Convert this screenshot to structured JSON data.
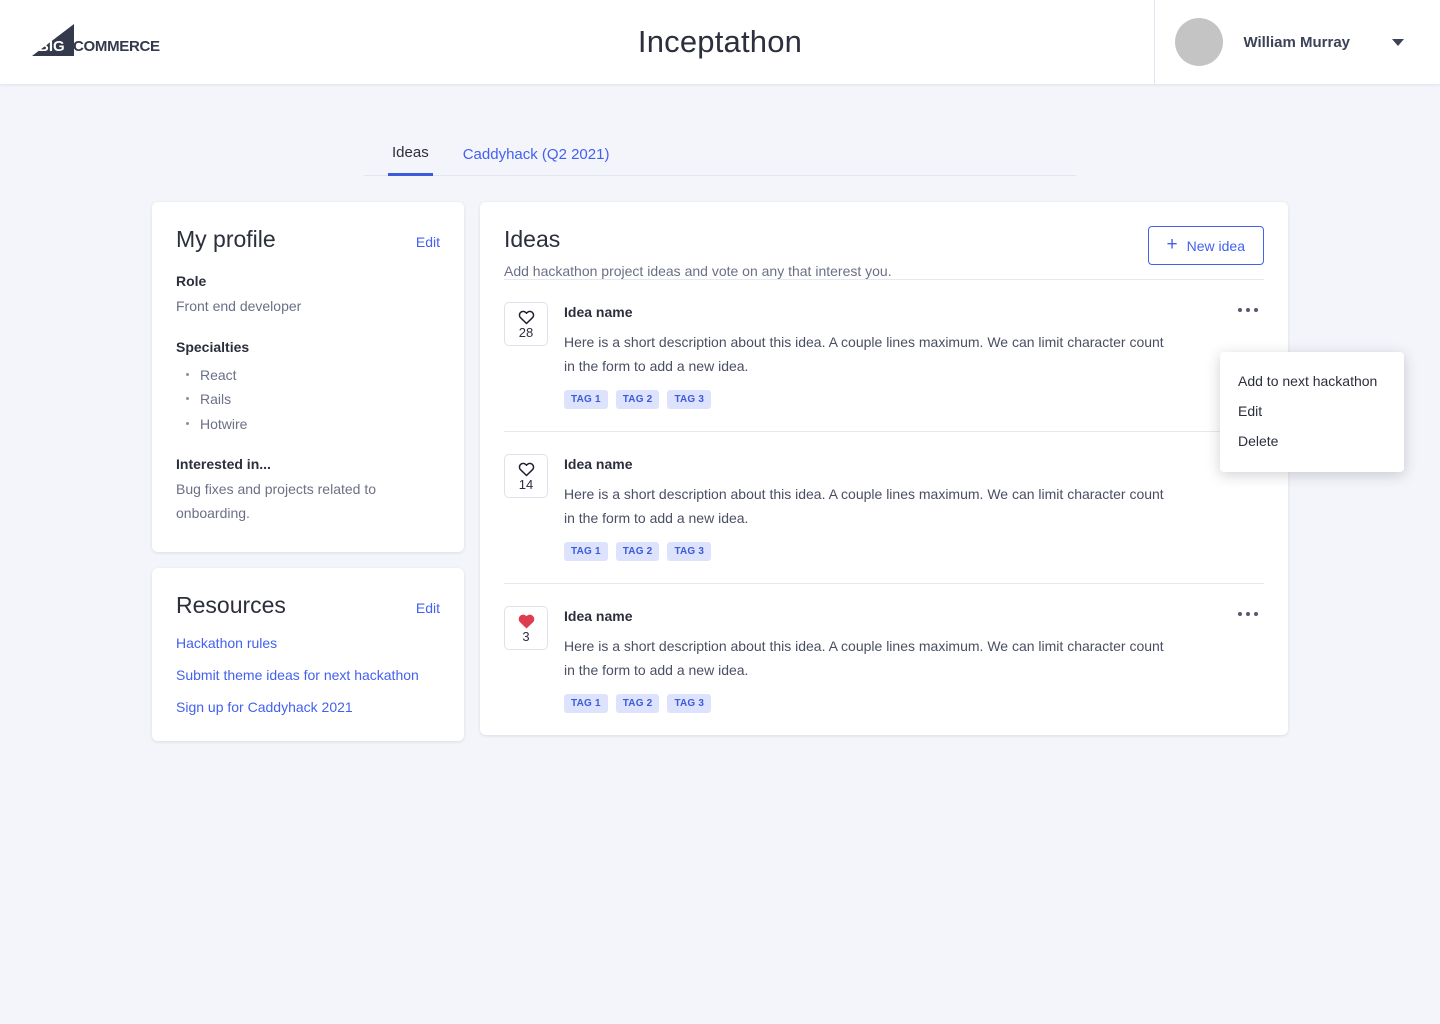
{
  "header": {
    "logo_alt": "BIGCOMMERCE",
    "logo_big": "BIG",
    "logo_commerce": "COMMERCE",
    "app_title": "Inceptathon",
    "user_name": "William Murray"
  },
  "tabs": [
    {
      "label": "Ideas",
      "active": true
    },
    {
      "label": "Caddyhack (Q2 2021)",
      "active": false
    }
  ],
  "profile": {
    "title": "My profile",
    "edit_label": "Edit",
    "role_label": "Role",
    "role_value": "Front end developer",
    "specialties_label": "Specialties",
    "specialties": [
      "React",
      "Rails",
      "Hotwire"
    ],
    "interested_label": "Interested in...",
    "interested_value": "Bug fixes and projects related to onboarding."
  },
  "resources": {
    "title": "Resources",
    "edit_label": "Edit",
    "links": [
      "Hackathon rules",
      "Submit theme ideas for next hackathon",
      "Sign up for Caddyhack 2021"
    ]
  },
  "ideas": {
    "title": "Ideas",
    "subtitle": "Add hackathon project ideas and vote on any that interest you.",
    "new_idea_label": "New idea",
    "plus_icon": "+",
    "items": [
      {
        "name": "Idea name",
        "description": "Here is a short description about this idea. A couple lines maximum. We can limit character count in the form to add a new idea.",
        "votes": "28",
        "voted": false,
        "tags": [
          "TAG 1",
          "TAG 2",
          "TAG 3"
        ]
      },
      {
        "name": "Idea name",
        "description": "Here is a short description about this idea. A couple lines maximum. We can limit character count in the form to add a new idea.",
        "votes": "14",
        "voted": false,
        "tags": [
          "TAG 1",
          "TAG 2",
          "TAG 3"
        ]
      },
      {
        "name": "Idea name",
        "description": "Here is a short description about this idea. A couple lines maximum. We can limit character count in the form to add a new idea.",
        "votes": "3",
        "voted": true,
        "tags": [
          "TAG 1",
          "TAG 2",
          "TAG 3"
        ]
      }
    ]
  },
  "context_menu": {
    "visible": true,
    "items": [
      "Add to next hackathon",
      "Edit",
      "Delete"
    ]
  },
  "colors": {
    "accent_blue": "#4361ee",
    "tab_active_underline": "#3b5bdb",
    "tag_bg": "#dde3fc",
    "tag_text": "#3b5bdb",
    "heart_filled": "#e03c50",
    "page_bg": "#f4f5fa"
  }
}
